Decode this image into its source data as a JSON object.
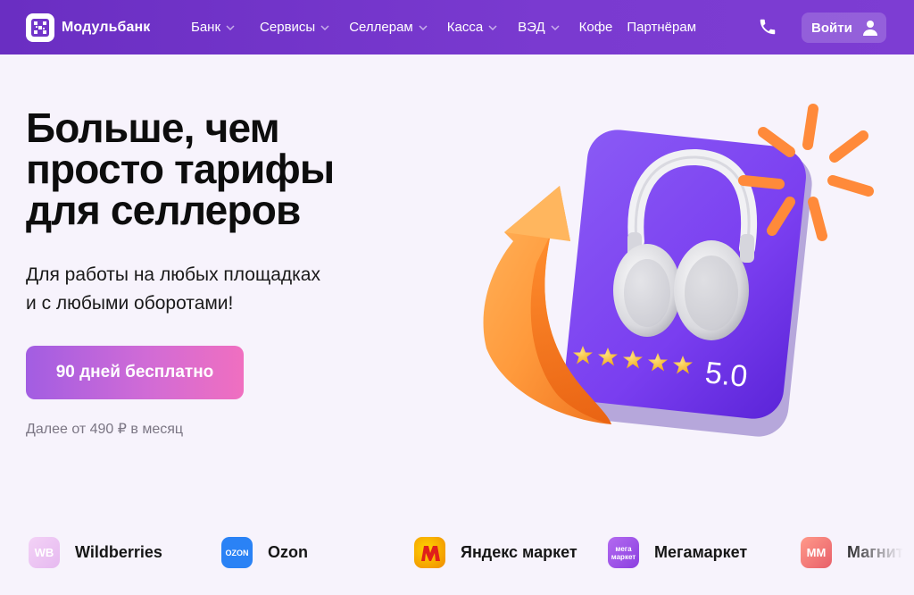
{
  "header": {
    "brand": "Модульбанк",
    "nav": [
      {
        "label": "Банк",
        "dropdown": true
      },
      {
        "label": "Сервисы",
        "dropdown": true
      },
      {
        "label": "Селлерам",
        "dropdown": true
      },
      {
        "label": "Касса",
        "dropdown": true
      },
      {
        "label": "ВЭД",
        "dropdown": true
      },
      {
        "label": "Кофе",
        "dropdown": false
      },
      {
        "label": "Партнёрам",
        "dropdown": false
      }
    ],
    "login_label": "Войти"
  },
  "hero": {
    "title_line1": "Больше, чем",
    "title_line2": "просто тарифы",
    "title_line3": "для селлеров",
    "subtitle_line1": "Для работы на любых площадках",
    "subtitle_line2": "и с любыми оборотами!",
    "cta_label": "90 дней бесплатно",
    "price_note": "Далее от 490 ₽ в месяц"
  },
  "illustration": {
    "rating": "5.0",
    "stars": 5
  },
  "marketplaces": [
    {
      "name": "Wildberries",
      "badge": "WB",
      "color": "#e9c3f2"
    },
    {
      "name": "Ozon",
      "badge": "OZON",
      "color": "#2a82f5"
    },
    {
      "name": "Яндекс маркет",
      "badge": "",
      "color": "#f2c500"
    },
    {
      "name": "Мегамаркет",
      "badge": "мега маркет",
      "color": "#9b4fe0"
    },
    {
      "name": "Магнит",
      "badge": "ММ",
      "color": "#f07a7a"
    }
  ],
  "colors": {
    "header_bg": "#7235c9",
    "accent_purple": "#7b3bd2",
    "cta_gradient_start": "#a25de2",
    "cta_gradient_end": "#f06fc0"
  },
  "icons": {
    "logo": "modulbank-logo-icon",
    "phone": "phone-icon",
    "user": "user-icon",
    "chevron": "chevron-down-icon"
  }
}
